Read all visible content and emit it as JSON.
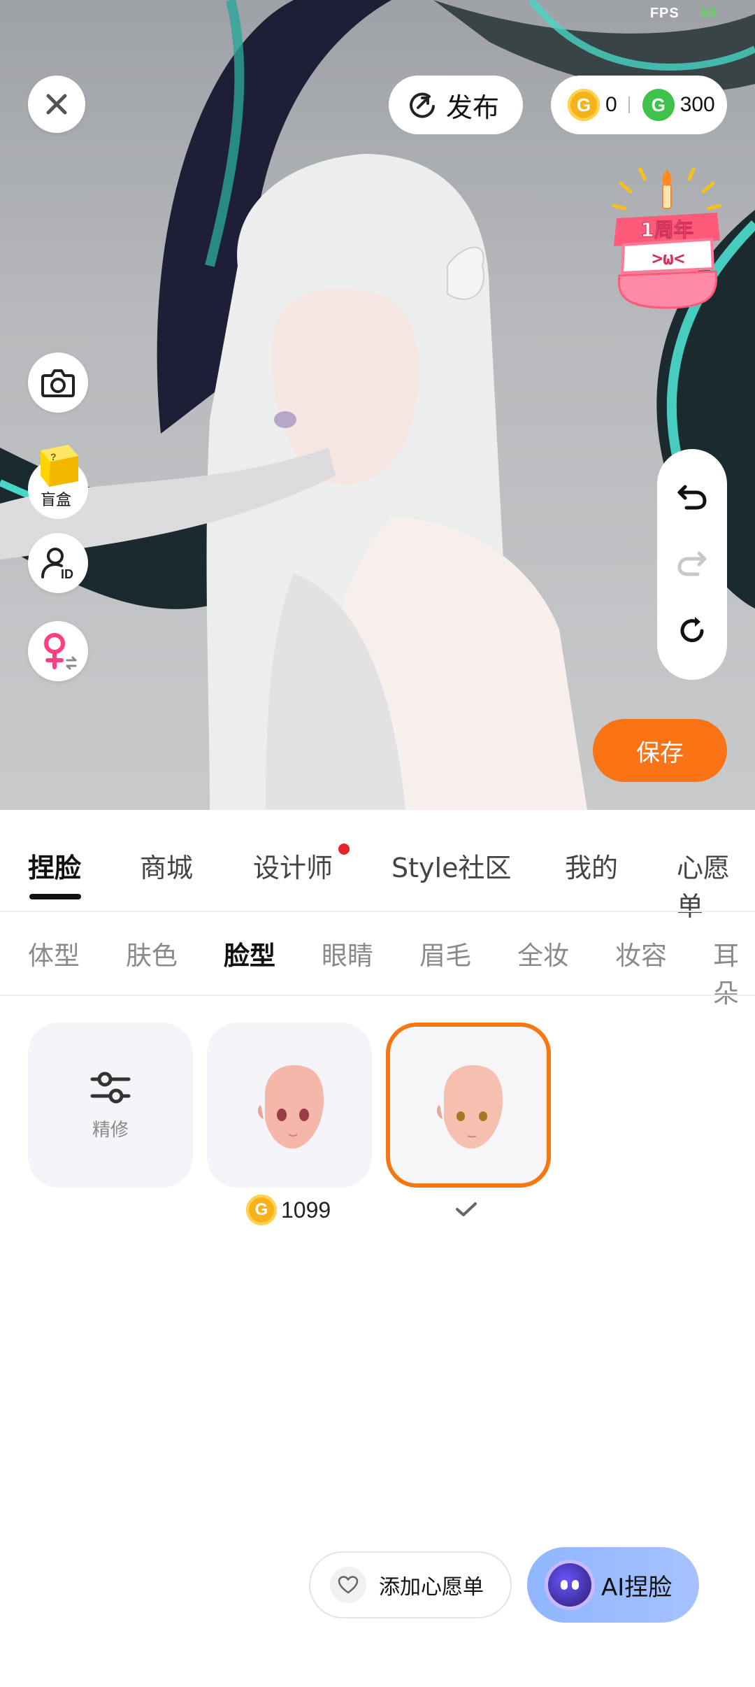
{
  "status": {
    "fps_label": "FPS",
    "fps_value": "59"
  },
  "topbar": {
    "close_icon": "close-icon",
    "publish_label": "发布",
    "gold_coin_value": "0",
    "green_coin_value": "300"
  },
  "anniversary_badge": {
    "line1": "1周年",
    "line2": ">ω<"
  },
  "left_tools": {
    "blindbox_label": "盲盒",
    "blindbox_icon_text": "?"
  },
  "right_tools": {
    "save_label": "保存"
  },
  "main_tabs": [
    "捏脸",
    "商城",
    "设计师",
    "Style社区",
    "我的",
    "心愿单"
  ],
  "sub_tabs": [
    "体型",
    "肤色",
    "脸型",
    "眼睛",
    "眉毛",
    "全妆",
    "妆容",
    "耳朵"
  ],
  "items": {
    "refine_label": "精修",
    "price_value": "1099"
  },
  "bottom_actions": {
    "wishlist_label": "添加心愿单",
    "ai_face_label": "AI捏脸"
  },
  "colors": {
    "accent": "#fa7314",
    "selected_border": "#f5770f",
    "ai_button": "#98b9ff",
    "gold_coin": "#f5b21c",
    "green_coin": "#3fc24b"
  }
}
